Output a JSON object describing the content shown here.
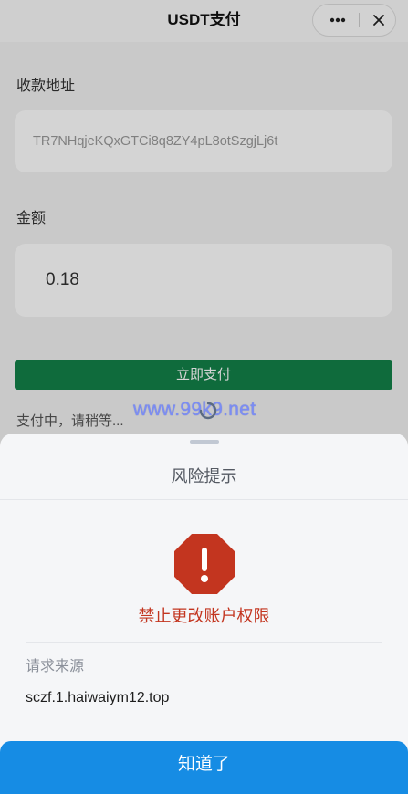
{
  "header": {
    "title": "USDT支付",
    "more_icon": "more-dots-icon",
    "close_icon": "close-icon"
  },
  "form": {
    "address_label": "收款地址",
    "address_value": "TR7NHqjeKQxGTCi8q8ZY4pL8otSzgjLj6t",
    "amount_label": "金额",
    "amount_value": "0.18",
    "pay_button": "立即支付",
    "status_text": "支付中，请稍等...",
    "spinner_icon": "loading-spinner-icon"
  },
  "watermark": "www.99k9.net",
  "sheet": {
    "title": "风险提示",
    "warning_icon": "warning-octagon-icon",
    "warning_text": "禁止更改账户权限",
    "source_label": "请求来源",
    "source_value": "sczf.1.haiwaiym12.top",
    "confirm_button": "知道了"
  },
  "colors": {
    "pay_green": "#138149",
    "danger_red": "#c3351f",
    "confirm_blue": "#168ce4"
  }
}
